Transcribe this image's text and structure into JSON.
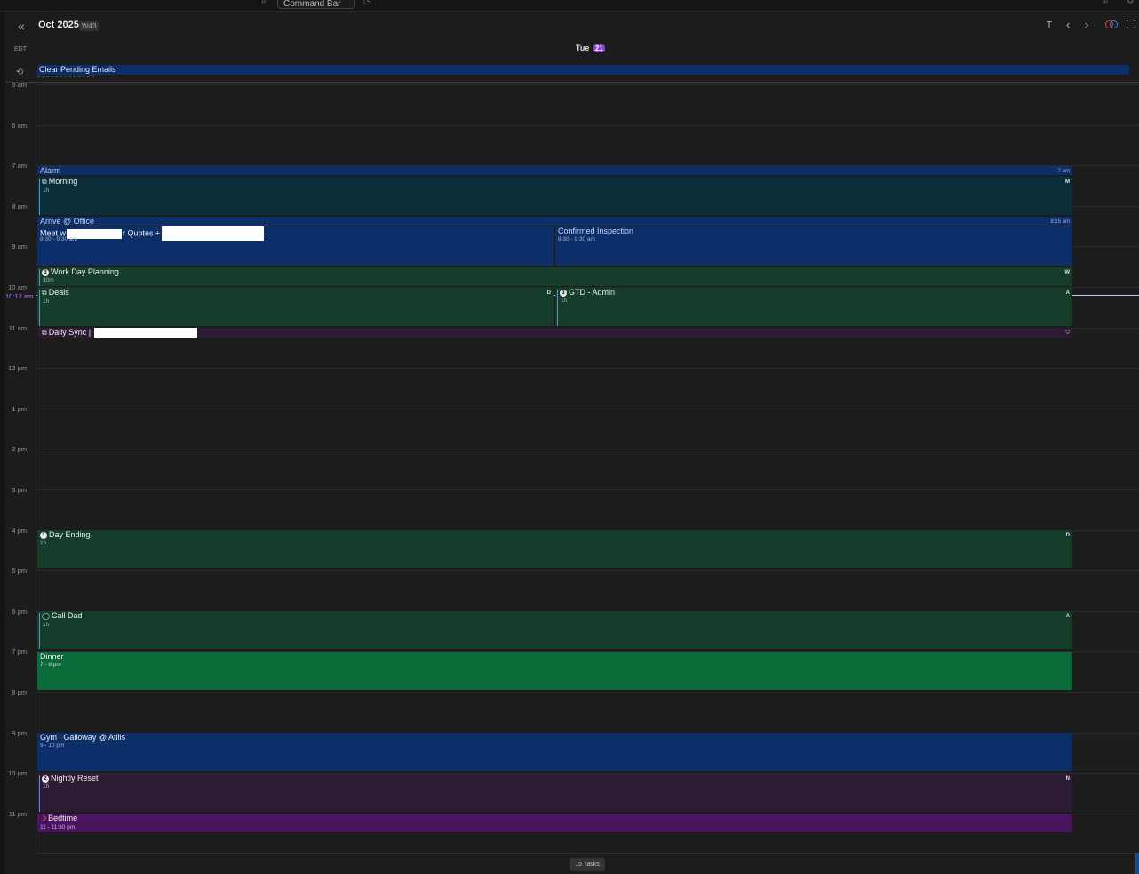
{
  "topbar": {
    "command_label": "Command Bar"
  },
  "header": {
    "month_title": "Oct 2025",
    "week_badge": "W43",
    "today_label": "T",
    "prev_label": "‹",
    "next_label": "›"
  },
  "timezone": "EDT",
  "day": {
    "label": "Tue",
    "number": "21"
  },
  "all_day": {
    "title": "Clear Pending Emails",
    "color": "#0c2f6a"
  },
  "hours": [
    "5 am",
    "6 am",
    "7 am",
    "8 am",
    "9 am",
    "10 am",
    "11 am",
    "12 pm",
    "1 pm",
    "2 pm",
    "3 pm",
    "4 pm",
    "5 pm",
    "6 pm",
    "7 pm",
    "8 pm",
    "9 pm",
    "10 pm",
    "11 pm"
  ],
  "now": {
    "label": "10:12 am"
  },
  "events": {
    "alarm": {
      "title": "Alarm",
      "time_right": "7 am"
    },
    "morning": {
      "title": "Morning",
      "duration": "1h",
      "tag": "M"
    },
    "arrive": {
      "title": "Arrive @ Office",
      "time_right": "8:15 am"
    },
    "meet": {
      "title_a": "Meet w",
      "title_b": "r Quotes +",
      "time": "8:30 - 9:30 am"
    },
    "inspection": {
      "title": "Confirmed Inspection",
      "time": "8:30 - 9:30 am"
    },
    "planning": {
      "badge": "3",
      "title": "Work Day Planning",
      "duration": "30m",
      "tag": "W"
    },
    "deals": {
      "title": "Deals",
      "duration": "1h",
      "tag": "D"
    },
    "gtd": {
      "badge": "3",
      "title": "GTD - Admin",
      "duration": "1h",
      "tag": "A"
    },
    "daily_sync": {
      "title": "Daily Sync |"
    },
    "day_ending": {
      "badge": "1",
      "title": "Day Ending",
      "duration": "1h",
      "tag": "D"
    },
    "call_dad": {
      "title": "Call Dad",
      "duration": "1h",
      "tag": "A"
    },
    "dinner": {
      "title": "Dinner",
      "time": "7 - 8 pm"
    },
    "gym": {
      "title": "Gym | Galloway @ Atilis",
      "time": "9 - 10 pm"
    },
    "nightly": {
      "badge": "2",
      "title": "Nightly Reset",
      "duration": "1h",
      "tag": "N"
    },
    "bedtime": {
      "title": "Bedtime",
      "time": "11 - 11:30 pm"
    }
  },
  "footer": {
    "tasks_label": "15 Tasks"
  },
  "colors": {
    "blue_event": "#0c2f6a",
    "teal_event": "#0a2e3a",
    "green_event": "#143e2a",
    "bright_green_event": "#0b6a3a",
    "purple_event": "#2c1b32",
    "bedtime_purple": "#4a145e",
    "day_badge": "#8b3fd9"
  }
}
